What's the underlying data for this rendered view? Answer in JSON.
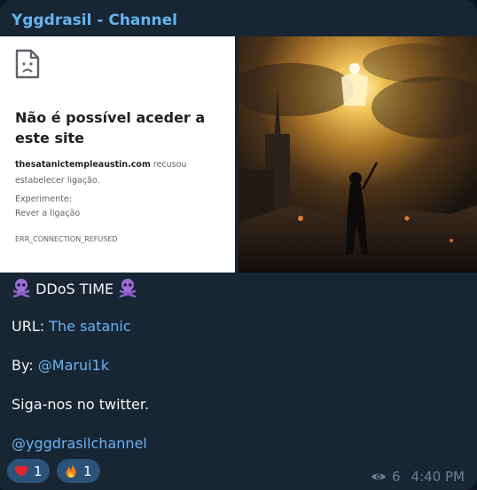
{
  "message": {
    "channel_name": "Yggdrasil - Channel",
    "error_page": {
      "title": "Não é possível aceder a este site",
      "domain": "thesatanictempleaustin.com",
      "reason": " recusou estabelecer ligação.",
      "try_label": "Experimente:",
      "try_item": "Rever a ligação",
      "code": "ERR_CONNECTION_REFUSED"
    },
    "body": {
      "headline": " DDoS TIME ",
      "url_label": "URL: ",
      "url_text": "The satanic",
      "by_label": "By: ",
      "by_handle": "@Marui1k",
      "follow_text": "Siga-nos no twitter.",
      "channel_handle": "@yggdrasilchannel"
    },
    "reactions": [
      {
        "icon": "heart-icon",
        "count": "1"
      },
      {
        "icon": "fire-icon",
        "count": "1"
      }
    ],
    "views": "6",
    "time": "4:40 PM"
  },
  "colors": {
    "bubble": "#182533",
    "accent_name": "#64b5ef",
    "link": "#6ab3f3",
    "reaction_bg": "#2b5278",
    "meta": "#6d7f8f"
  }
}
